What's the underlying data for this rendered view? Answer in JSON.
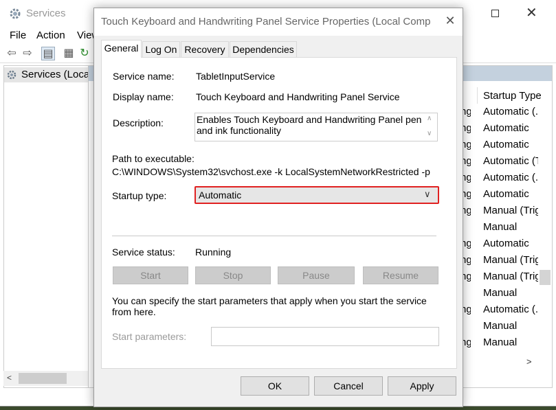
{
  "services_window": {
    "title": "Services",
    "menu": [
      "File",
      "Action",
      "View"
    ],
    "tree_item": "Services (Local)",
    "column_header": "Startup Type",
    "rows": [
      {
        "left": "ng",
        "startup": "Automatic (..."
      },
      {
        "left": "ng",
        "startup": "Automatic"
      },
      {
        "left": "ng",
        "startup": "Automatic"
      },
      {
        "left": "ng",
        "startup": "Automatic (T..."
      },
      {
        "left": "ng",
        "startup": "Automatic (..."
      },
      {
        "left": "ng",
        "startup": "Automatic"
      },
      {
        "left": "ng",
        "startup": "Manual (Trig..."
      },
      {
        "left": "",
        "startup": "Manual"
      },
      {
        "left": "ng",
        "startup": "Automatic"
      },
      {
        "left": "ng",
        "startup": "Manual (Trig..."
      },
      {
        "left": "ng",
        "startup": "Manual (Trig..."
      },
      {
        "left": "",
        "startup": "Manual"
      },
      {
        "left": "ng",
        "startup": "Automatic (..."
      },
      {
        "left": "",
        "startup": "Manual"
      },
      {
        "left": "ng",
        "startup": "Manual"
      }
    ]
  },
  "dialog": {
    "title": "Touch Keyboard and Handwriting Panel Service Properties (Local Computer)",
    "tabs": [
      "General",
      "Log On",
      "Recovery",
      "Dependencies"
    ],
    "service_name_label": "Service name:",
    "service_name": "TabletInputService",
    "display_name_label": "Display name:",
    "display_name": "Touch Keyboard and Handwriting Panel Service",
    "description_label": "Description:",
    "description": "Enables Touch Keyboard and Handwriting Panel pen and ink functionality",
    "path_label": "Path to executable:",
    "path": "C:\\WINDOWS\\System32\\svchost.exe -k LocalSystemNetworkRestricted -p",
    "startup_type_label": "Startup type:",
    "startup_type": "Automatic",
    "service_status_label": "Service status:",
    "service_status": "Running",
    "buttons": {
      "start": "Start",
      "stop": "Stop",
      "pause": "Pause",
      "resume": "Resume"
    },
    "params_note": "You can specify the start parameters that apply when you start the service from here.",
    "start_parameters_label": "Start parameters:",
    "start_parameters_value": "",
    "ok": "OK",
    "cancel": "Cancel",
    "apply": "Apply"
  },
  "colors": {
    "highlight_border": "#e02020",
    "list_header_band": "#c4d1de"
  }
}
